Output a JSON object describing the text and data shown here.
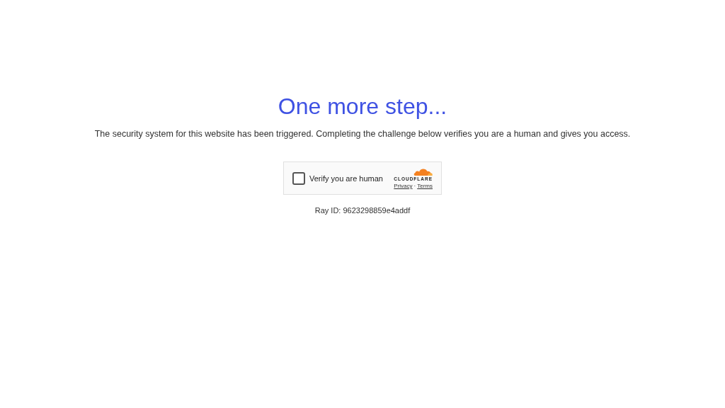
{
  "heading": "One more step...",
  "message": "The security system for this website has been triggered. Completing the challenge below verifies you are a human and gives you access.",
  "challenge": {
    "label": "Verify you are human",
    "checked": false,
    "brand": "CLOUDFLARE",
    "links": [
      "Privacy",
      "Terms"
    ],
    "separator": "·"
  },
  "ray_id": "Ray ID: 9623298859e4addf"
}
